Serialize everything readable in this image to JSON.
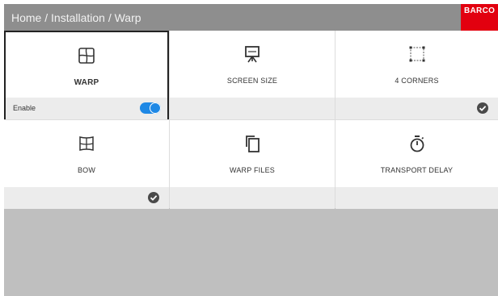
{
  "header": {
    "breadcrumb": "Home / Installation / Warp",
    "logo_text": "BARCO"
  },
  "tiles": [
    {
      "label": "WARP",
      "icon": "warp-icon",
      "footer": {
        "text": "Enable",
        "toggle_on": true
      }
    },
    {
      "label": "SCREEN SIZE",
      "icon": "screen-size-icon",
      "footer": {}
    },
    {
      "label": "4 CORNERS",
      "icon": "four-corners-icon",
      "footer": {
        "checked": true
      }
    },
    {
      "label": "BOW",
      "icon": "bow-icon",
      "footer": {
        "checked": true
      }
    },
    {
      "label": "WARP FILES",
      "icon": "warp-files-icon",
      "footer": {}
    },
    {
      "label": "TRANSPORT DELAY",
      "icon": "stopwatch-icon",
      "footer": {}
    }
  ],
  "colors": {
    "header_bg": "#8e8e8e",
    "brand_red": "#e2000f",
    "toggle_blue": "#1e88e5",
    "check_gray": "#4a4a4a"
  }
}
